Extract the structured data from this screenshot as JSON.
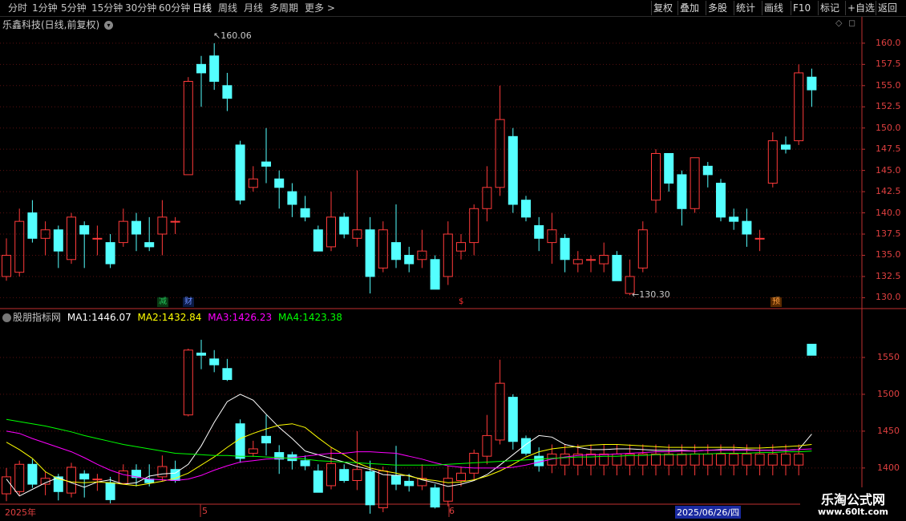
{
  "toolbar": {
    "periods": [
      "分时",
      "1分钟",
      "5分钟",
      "15分钟",
      "30分钟",
      "60分钟",
      "日线",
      "周线",
      "月线",
      "多周期",
      "更多"
    ],
    "active_period": "日线",
    "more_arrow": ">",
    "right_buttons": [
      "复权",
      "叠加",
      "多股",
      "统计",
      "画线",
      "F10",
      "标记",
      "+自选",
      "返回"
    ]
  },
  "main_panel": {
    "title": "乐鑫科技(日线,前复权)",
    "title_icon": "chevron-down-icon",
    "high_label": "160.06",
    "low_label": "130.30",
    "y_ticks": [
      "160.0",
      "157.5",
      "155.0",
      "152.5",
      "150.0",
      "147.5",
      "145.0",
      "142.5",
      "140.0",
      "137.5",
      "135.0",
      "132.5",
      "130.0"
    ],
    "markers": [
      {
        "text": "减",
        "color": "#22c05a"
      },
      {
        "text": "财",
        "color": "#3a6cf0"
      },
      {
        "text": "$",
        "color": "#ff3030"
      },
      {
        "text": "预",
        "color": "#e07020"
      }
    ]
  },
  "sub_panel": {
    "name": "股朋指标网",
    "ma1_label": "MA1:",
    "ma1_value": "1446.07",
    "ma2_label": "MA2:",
    "ma2_value": "1432.84",
    "ma3_label": "MA3:",
    "ma3_value": "1426.23",
    "ma4_label": "MA4:",
    "ma4_value": "1423.38",
    "y_ticks": [
      "1550",
      "1500",
      "1450",
      "1400"
    ]
  },
  "date_axis": {
    "year": "2025年",
    "month5": "5",
    "month6": "6",
    "cursor_date": "2025/06/26/四"
  },
  "watermark": {
    "title": "乐淘公式网",
    "url": "www.60lt.com"
  },
  "colors": {
    "up": "#ff3a3a",
    "down": "#54ffff",
    "ma1": "#ffffff",
    "ma2": "#ffff00",
    "ma3": "#ff00ff",
    "ma4": "#00ff00",
    "axis": "#e04040"
  },
  "chart_data": {
    "type": "candlestick",
    "ylim": [
      129,
      161.5
    ],
    "candles": [
      {
        "o": 132.5,
        "c": 135.0,
        "h": 137.0,
        "l": 132.0
      },
      {
        "o": 133.0,
        "c": 139.0,
        "h": 140.5,
        "l": 132.5
      },
      {
        "o": 140.0,
        "c": 137.0,
        "h": 141.5,
        "l": 136.5
      },
      {
        "o": 137.0,
        "c": 138.0,
        "h": 139.0,
        "l": 135.0
      },
      {
        "o": 138.0,
        "c": 135.5,
        "h": 138.5,
        "l": 133.5
      },
      {
        "o": 134.5,
        "c": 139.5,
        "h": 140.0,
        "l": 134.0
      },
      {
        "o": 138.5,
        "c": 137.5,
        "h": 139.0,
        "l": 133.5
      },
      {
        "o": 137.0,
        "c": 137.0,
        "h": 138.5,
        "l": 135.0
      },
      {
        "o": 136.5,
        "c": 134.0,
        "h": 137.5,
        "l": 133.5
      },
      {
        "o": 136.5,
        "c": 139.0,
        "h": 140.5,
        "l": 136.0
      },
      {
        "o": 139.0,
        "c": 137.5,
        "h": 140.0,
        "l": 135.5
      },
      {
        "o": 136.5,
        "c": 136.0,
        "h": 139.5,
        "l": 135.5
      },
      {
        "o": 137.5,
        "c": 139.5,
        "h": 141.5,
        "l": 135.0
      },
      {
        "o": 139.0,
        "c": 139.0,
        "h": 139.5,
        "l": 137.5
      },
      {
        "o": 144.5,
        "c": 155.5,
        "h": 156.0,
        "l": 144.5
      },
      {
        "o": 157.5,
        "c": 156.5,
        "h": 158.5,
        "l": 152.5
      },
      {
        "o": 158.5,
        "c": 155.5,
        "h": 160.0,
        "l": 154.5
      },
      {
        "o": 155.0,
        "c": 153.5,
        "h": 156.5,
        "l": 152.0
      },
      {
        "o": 148.0,
        "c": 141.5,
        "h": 148.5,
        "l": 141.0
      },
      {
        "o": 143.0,
        "c": 144.0,
        "h": 145.5,
        "l": 142.5
      },
      {
        "o": 146.0,
        "c": 145.5,
        "h": 150.0,
        "l": 143.5
      },
      {
        "o": 144.0,
        "c": 143.0,
        "h": 145.0,
        "l": 140.5
      },
      {
        "o": 142.5,
        "c": 141.0,
        "h": 143.5,
        "l": 139.5
      },
      {
        "o": 140.5,
        "c": 139.5,
        "h": 142.0,
        "l": 139.0
      },
      {
        "o": 138.0,
        "c": 135.5,
        "h": 138.5,
        "l": 135.5
      },
      {
        "o": 136.0,
        "c": 139.5,
        "h": 142.5,
        "l": 135.5
      },
      {
        "o": 139.5,
        "c": 137.5,
        "h": 140.0,
        "l": 137.0
      },
      {
        "o": 137.0,
        "c": 138.0,
        "h": 145.0,
        "l": 136.0
      },
      {
        "o": 138.0,
        "c": 132.5,
        "h": 139.5,
        "l": 130.5
      },
      {
        "o": 133.5,
        "c": 138.0,
        "h": 139.0,
        "l": 133.0
      },
      {
        "o": 136.5,
        "c": 134.5,
        "h": 141.0,
        "l": 133.5
      },
      {
        "o": 135.0,
        "c": 134.0,
        "h": 136.0,
        "l": 133.0
      },
      {
        "o": 134.5,
        "c": 135.5,
        "h": 138.0,
        "l": 133.5
      },
      {
        "o": 134.5,
        "c": 131.0,
        "h": 135.0,
        "l": 131.0
      },
      {
        "o": 132.5,
        "c": 137.5,
        "h": 139.0,
        "l": 131.5
      },
      {
        "o": 135.5,
        "c": 136.5,
        "h": 137.5,
        "l": 134.5
      },
      {
        "o": 136.5,
        "c": 140.5,
        "h": 141.0,
        "l": 135.0
      },
      {
        "o": 140.5,
        "c": 143.0,
        "h": 145.5,
        "l": 139.0
      },
      {
        "o": 143.0,
        "c": 151.0,
        "h": 155.0,
        "l": 142.0
      },
      {
        "o": 149.0,
        "c": 141.0,
        "h": 150.0,
        "l": 140.0
      },
      {
        "o": 141.5,
        "c": 139.5,
        "h": 142.0,
        "l": 139.0
      },
      {
        "o": 138.5,
        "c": 137.0,
        "h": 139.5,
        "l": 135.5
      },
      {
        "o": 136.5,
        "c": 138.0,
        "h": 140.0,
        "l": 134.0
      },
      {
        "o": 137.0,
        "c": 134.5,
        "h": 137.5,
        "l": 133.0
      },
      {
        "o": 134.0,
        "c": 134.5,
        "h": 135.5,
        "l": 133.0
      },
      {
        "o": 134.5,
        "c": 134.5,
        "h": 135.0,
        "l": 133.0
      },
      {
        "o": 134.0,
        "c": 135.0,
        "h": 136.5,
        "l": 133.0
      },
      {
        "o": 135.0,
        "c": 132.0,
        "h": 135.5,
        "l": 132.0
      },
      {
        "o": 130.5,
        "c": 132.5,
        "h": 134.5,
        "l": 130.3
      },
      {
        "o": 133.5,
        "c": 138.0,
        "h": 139.0,
        "l": 133.0
      },
      {
        "o": 141.5,
        "c": 147.0,
        "h": 147.5,
        "l": 140.0
      },
      {
        "o": 147.0,
        "c": 143.5,
        "h": 147.0,
        "l": 142.5
      },
      {
        "o": 144.5,
        "c": 140.5,
        "h": 145.0,
        "l": 138.5
      },
      {
        "o": 140.5,
        "c": 146.5,
        "h": 146.5,
        "l": 140.0
      },
      {
        "o": 145.5,
        "c": 144.5,
        "h": 146.0,
        "l": 143.0
      },
      {
        "o": 143.5,
        "c": 139.5,
        "h": 144.0,
        "l": 139.0
      },
      {
        "o": 139.5,
        "c": 139.0,
        "h": 140.5,
        "l": 138.0
      },
      {
        "o": 139.0,
        "c": 137.5,
        "h": 140.5,
        "l": 136.0
      },
      {
        "o": 137.0,
        "c": 137.0,
        "h": 138.0,
        "l": 135.5
      },
      {
        "o": 143.5,
        "c": 148.5,
        "h": 149.5,
        "l": 143.0
      },
      {
        "o": 148.0,
        "c": 147.5,
        "h": 149.0,
        "l": 147.0
      },
      {
        "o": 148.5,
        "c": 156.5,
        "h": 157.5,
        "l": 148.0
      },
      {
        "o": 156.0,
        "c": 154.5,
        "h": 157.0,
        "l": 152.5
      }
    ],
    "sub_ylim": [
      1352,
      1600
    ],
    "sub_candles": [
      {
        "o": 1365,
        "c": 1388,
        "h": 1400,
        "l": 1355
      },
      {
        "o": 1368,
        "c": 1405,
        "h": 1410,
        "l": 1362
      },
      {
        "o": 1405,
        "c": 1378,
        "h": 1412,
        "l": 1373
      },
      {
        "o": 1378,
        "c": 1386,
        "h": 1395,
        "l": 1363
      },
      {
        "o": 1388,
        "c": 1368,
        "h": 1392,
        "l": 1356
      },
      {
        "o": 1366,
        "c": 1401,
        "h": 1407,
        "l": 1360
      },
      {
        "o": 1392,
        "c": 1385,
        "h": 1397,
        "l": 1360
      },
      {
        "o": 1385,
        "c": 1385,
        "h": 1392,
        "l": 1369
      },
      {
        "o": 1380,
        "c": 1357,
        "h": 1388,
        "l": 1352
      },
      {
        "o": 1379,
        "c": 1396,
        "h": 1405,
        "l": 1378
      },
      {
        "o": 1397,
        "c": 1387,
        "h": 1405,
        "l": 1375
      },
      {
        "o": 1385,
        "c": 1380,
        "h": 1405,
        "l": 1375
      },
      {
        "o": 1388,
        "c": 1402,
        "h": 1417,
        "l": 1382
      },
      {
        "o": 1398,
        "c": 1383,
        "h": 1410,
        "l": 1380
      },
      {
        "o": 1472,
        "c": 1560,
        "h": 1562,
        "l": 1470
      },
      {
        "o": 1556,
        "c": 1553,
        "h": 1574,
        "l": 1534
      },
      {
        "o": 1548,
        "c": 1540,
        "h": 1560,
        "l": 1530
      },
      {
        "o": 1535,
        "c": 1520,
        "h": 1548,
        "l": 1518
      },
      {
        "o": 1460,
        "c": 1413,
        "h": 1466,
        "l": 1407
      },
      {
        "o": 1420,
        "c": 1426,
        "h": 1437,
        "l": 1415
      },
      {
        "o": 1443,
        "c": 1434,
        "h": 1472,
        "l": 1417
      },
      {
        "o": 1421,
        "c": 1412,
        "h": 1431,
        "l": 1392
      },
      {
        "o": 1418,
        "c": 1410,
        "h": 1422,
        "l": 1398
      },
      {
        "o": 1410,
        "c": 1403,
        "h": 1417,
        "l": 1397
      },
      {
        "o": 1396,
        "c": 1367,
        "h": 1405,
        "l": 1367
      },
      {
        "o": 1376,
        "c": 1406,
        "h": 1428,
        "l": 1371
      },
      {
        "o": 1398,
        "c": 1383,
        "h": 1405,
        "l": 1380
      },
      {
        "o": 1383,
        "c": 1398,
        "h": 1450,
        "l": 1370
      },
      {
        "o": 1395,
        "c": 1350,
        "h": 1410,
        "l": 1338
      },
      {
        "o": 1346,
        "c": 1396,
        "h": 1402,
        "l": 1340
      },
      {
        "o": 1390,
        "c": 1378,
        "h": 1430,
        "l": 1370
      },
      {
        "o": 1382,
        "c": 1376,
        "h": 1392,
        "l": 1368
      },
      {
        "o": 1376,
        "c": 1386,
        "h": 1405,
        "l": 1370
      },
      {
        "o": 1373,
        "c": 1347,
        "h": 1378,
        "l": 1345
      },
      {
        "o": 1355,
        "c": 1386,
        "h": 1403,
        "l": 1348
      },
      {
        "o": 1383,
        "c": 1393,
        "h": 1402,
        "l": 1375
      },
      {
        "o": 1393,
        "c": 1420,
        "h": 1425,
        "l": 1383
      },
      {
        "o": 1416,
        "c": 1444,
        "h": 1472,
        "l": 1405
      },
      {
        "o": 1438,
        "c": 1515,
        "h": 1547,
        "l": 1432
      },
      {
        "o": 1496,
        "c": 1436,
        "h": 1500,
        "l": 1425
      },
      {
        "o": 1440,
        "c": 1420,
        "h": 1444,
        "l": 1417
      },
      {
        "o": 1416,
        "c": 1403,
        "h": 1428,
        "l": 1395
      },
      {
        "o": 1404,
        "c": 1419,
        "h": 1432,
        "l": 1393
      },
      {
        "o": 1404,
        "c": 1419,
        "h": 1432,
        "l": 1390
      },
      {
        "o": 1404,
        "c": 1419,
        "h": 1432,
        "l": 1390
      },
      {
        "o": 1404,
        "c": 1419,
        "h": 1432,
        "l": 1390
      },
      {
        "o": 1404,
        "c": 1419,
        "h": 1432,
        "l": 1390
      },
      {
        "o": 1404,
        "c": 1419,
        "h": 1432,
        "l": 1390
      },
      {
        "o": 1404,
        "c": 1419,
        "h": 1432,
        "l": 1390
      },
      {
        "o": 1404,
        "c": 1419,
        "h": 1432,
        "l": 1390
      },
      {
        "o": 1404,
        "c": 1419,
        "h": 1432,
        "l": 1390
      },
      {
        "o": 1404,
        "c": 1419,
        "h": 1432,
        "l": 1390
      },
      {
        "o": 1404,
        "c": 1419,
        "h": 1432,
        "l": 1390
      },
      {
        "o": 1404,
        "c": 1419,
        "h": 1432,
        "l": 1390
      },
      {
        "o": 1404,
        "c": 1419,
        "h": 1432,
        "l": 1390
      },
      {
        "o": 1404,
        "c": 1419,
        "h": 1432,
        "l": 1390
      },
      {
        "o": 1404,
        "c": 1419,
        "h": 1432,
        "l": 1390
      },
      {
        "o": 1404,
        "c": 1419,
        "h": 1432,
        "l": 1390
      },
      {
        "o": 1404,
        "c": 1419,
        "h": 1432,
        "l": 1390
      },
      {
        "o": 1404,
        "c": 1419,
        "h": 1432,
        "l": 1390
      },
      {
        "o": 1404,
        "c": 1419,
        "h": 1432,
        "l": 1390
      },
      {
        "o": 1404,
        "c": 1419,
        "h": 1432,
        "l": 1390
      },
      {
        "o": 1568,
        "c": 1553,
        "h": 1568,
        "l": 1553
      }
    ],
    "ma_series": [
      {
        "name": "MA1",
        "color": "#ffffff",
        "values": [
          1385,
          1362,
          1371,
          1380,
          1387,
          1380,
          1374,
          1381,
          1384,
          1378,
          1380,
          1389,
          1392,
          1393,
          1405,
          1430,
          1462,
          1490,
          1500,
          1492,
          1473,
          1455,
          1440,
          1423,
          1418,
          1413,
          1408,
          1402,
          1398,
          1391,
          1390,
          1390,
          1384,
          1380,
          1375,
          1378,
          1383,
          1391,
          1404,
          1418,
          1432,
          1444,
          1442,
          1432,
          1428,
          1425,
          1425,
          1426,
          1426,
          1425,
          1424,
          1424,
          1424,
          1423,
          1424,
          1425,
          1425,
          1425,
          1424,
          1424,
          1424,
          1425,
          1446
        ]
      },
      {
        "name": "MA2",
        "color": "#ffff00",
        "values": [
          1435,
          1425,
          1413,
          1395,
          1385,
          1381,
          1380,
          1381,
          1380,
          1378,
          1376,
          1379,
          1382,
          1386,
          1393,
          1404,
          1415,
          1428,
          1440,
          1447,
          1453,
          1458,
          1460,
          1455,
          1441,
          1428,
          1418,
          1407,
          1400,
          1396,
          1393,
          1389,
          1385,
          1383,
          1380,
          1381,
          1384,
          1389,
          1396,
          1405,
          1415,
          1422,
          1426,
          1428,
          1429,
          1431,
          1432,
          1432,
          1431,
          1430,
          1429,
          1428,
          1428,
          1428,
          1428,
          1428,
          1428,
          1427,
          1427,
          1428,
          1429,
          1430,
          1432
        ]
      },
      {
        "name": "MA3",
        "color": "#ff00ff",
        "values": [
          1450,
          1447,
          1440,
          1434,
          1428,
          1422,
          1414,
          1405,
          1397,
          1391,
          1388,
          1385,
          1384,
          1383,
          1385,
          1390,
          1397,
          1403,
          1408,
          1410,
          1412,
          1413,
          1414,
          1416,
          1418,
          1420,
          1420,
          1422,
          1422,
          1421,
          1420,
          1416,
          1412,
          1407,
          1403,
          1401,
          1400,
          1400,
          1400,
          1401,
          1404,
          1408,
          1412,
          1415,
          1417,
          1418,
          1418,
          1419,
          1420,
          1421,
          1422,
          1422,
          1423,
          1423,
          1424,
          1424,
          1424,
          1424,
          1424,
          1424,
          1424,
          1425,
          1426
        ]
      },
      {
        "name": "MA4",
        "color": "#00ff00",
        "values": [
          1466,
          1463,
          1460,
          1457,
          1453,
          1449,
          1444,
          1440,
          1436,
          1432,
          1429,
          1426,
          1423,
          1420,
          1419,
          1418,
          1417,
          1417,
          1416,
          1416,
          1415,
          1414,
          1413,
          1412,
          1410,
          1409,
          1408,
          1407,
          1406,
          1405,
          1404,
          1404,
          1404,
          1404,
          1405,
          1406,
          1407,
          1408,
          1409,
          1410,
          1411,
          1412,
          1413,
          1414,
          1415,
          1415,
          1416,
          1416,
          1417,
          1417,
          1418,
          1418,
          1418,
          1419,
          1419,
          1420,
          1420,
          1420,
          1421,
          1421,
          1422,
          1422,
          1423
        ]
      }
    ]
  }
}
